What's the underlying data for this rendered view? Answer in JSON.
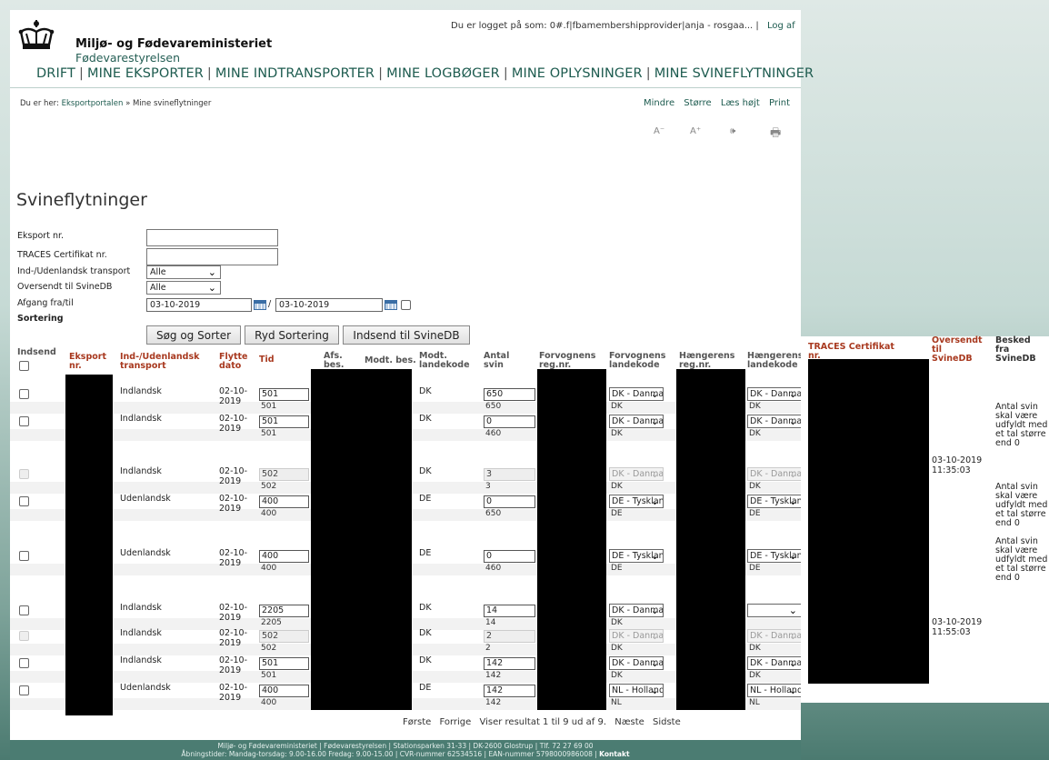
{
  "header": {
    "ministry": "Miljø- og Fødevareministeriet",
    "agency": "Fødevarestyrelsen",
    "login_text": "Du er logget på som: 0#.f|fbamembershipprovider|anja - rosgaa... |",
    "logout": "Log af",
    "nav": [
      "DRIFT",
      "MINE EKSPORTER",
      "MINE INDTRANSPORTER",
      "MINE LOGBØGER",
      "MINE OPLYSNINGER",
      "MINE SVINEFLYTNINGER"
    ]
  },
  "breadcrumb": {
    "prefix": "Du er her:",
    "link": "Eksportportalen",
    "sep": "»",
    "current": "Mine svineflytninger"
  },
  "tools": {
    "smaller": "Mindre",
    "larger": "Større",
    "read": "Læs højt",
    "print": "Print",
    "icon_smaller": "A⁻",
    "icon_larger": "A⁺",
    "icon_read": "🕪",
    "icon_print": "🖶"
  },
  "title": "Svineflytninger",
  "form": {
    "eksport_label": "Eksport nr.",
    "traces_label": "TRACES Certifikat nr.",
    "transport_label": "Ind-/Udenlandsk transport",
    "transport_value": "Alle",
    "sent_label": "Oversendt til SvineDB",
    "sent_value": "Alle",
    "date_label": "Afgang fra/til",
    "date_from": "03-10-2019",
    "date_sep": "/",
    "date_to": "03-10-2019",
    "sort_label": "Sortering"
  },
  "buttons": {
    "search": "Søg og Sorter",
    "clear": "Ryd Sortering",
    "submit": "Indsend til SvineDB"
  },
  "headers": {
    "indsend": "Indsend",
    "eksport": "Eksport nr.",
    "transport": "Ind-/Udenlandsk transport",
    "dato": "Flytte dato",
    "tid": "Tid",
    "afs": "Afs. bes.",
    "modt": "Modt. bes.",
    "modt_land": "Modt. landekode",
    "antal": "Antal svin",
    "forv_reg": "Forvognens reg.nr.",
    "forv_land": "Forvognens landekode",
    "haeng_reg": "Hængerens reg.nr.",
    "haeng_land": "Hængerens landekode",
    "traces": "TRACES Certifikat nr.",
    "oversendt": "Oversendt til SvineDB",
    "besked": "Besked fra SvineDB"
  },
  "rows": [
    {
      "transport": "Indlandsk",
      "date": "02-10-2019",
      "tid": "501",
      "tid_sub": "501",
      "land": "DK",
      "antal": "650",
      "antal_sub": "650",
      "forv": "DK - Danmark",
      "forv_sub": "DK",
      "haeng": "DK - Danmark",
      "haeng_sub": "DK",
      "oversendt": "",
      "besked": "",
      "disabled": false
    },
    {
      "transport": "Indlandsk",
      "date": "02-10-2019",
      "tid": "501",
      "tid_sub": "501",
      "land": "DK",
      "antal": "0",
      "antal_sub": "460",
      "forv": "DK - Danmark",
      "forv_sub": "DK",
      "haeng": "DK - Danmark",
      "haeng_sub": "DK",
      "oversendt": "",
      "besked": "Antal svin skal være udfyldt med et tal større end 0",
      "disabled": false
    },
    {
      "transport": "Indlandsk",
      "date": "02-10-2019",
      "tid": "502",
      "tid_sub": "502",
      "land": "DK",
      "antal": "3",
      "antal_sub": "3",
      "forv": "DK - Danmark",
      "forv_sub": "DK",
      "haeng": "DK - Danmark",
      "haeng_sub": "DK",
      "oversendt": "03-10-2019 11:35:03",
      "besked": "",
      "disabled": true
    },
    {
      "transport": "Udenlandsk",
      "date": "02-10-2019",
      "tid": "400",
      "tid_sub": "400",
      "land": "DE",
      "antal": "0",
      "antal_sub": "650",
      "forv": "DE - Tyskland",
      "forv_sub": "DE",
      "haeng": "DE - Tyskland",
      "haeng_sub": "DE",
      "oversendt": "",
      "besked": "Antal svin skal være udfyldt med et tal større end 0",
      "disabled": false
    },
    {
      "transport": "Udenlandsk",
      "date": "02-10-2019",
      "tid": "400",
      "tid_sub": "400",
      "land": "DE",
      "antal": "0",
      "antal_sub": "460",
      "forv": "DE - Tyskland",
      "forv_sub": "DE",
      "haeng": "DE - Tyskland",
      "haeng_sub": "DE",
      "oversendt": "",
      "besked": "Antal svin skal være udfyldt med et tal større end 0",
      "disabled": false
    },
    {
      "transport": "Indlandsk",
      "date": "02-10-2019",
      "tid": "2205",
      "tid_sub": "2205",
      "land": "DK",
      "antal": "14",
      "antal_sub": "14",
      "forv": "DK - Danmark",
      "forv_sub": "DK",
      "haeng": "",
      "haeng_sub": "",
      "oversendt": "",
      "besked": "",
      "disabled": false
    },
    {
      "transport": "Indlandsk",
      "date": "02-10-2019",
      "tid": "502",
      "tid_sub": "502",
      "land": "DK",
      "antal": "2",
      "antal_sub": "2",
      "forv": "DK - Danmark",
      "forv_sub": "DK",
      "haeng": "DK - Danmark",
      "haeng_sub": "DK",
      "oversendt": "03-10-2019 11:55:03",
      "besked": "",
      "disabled": true
    },
    {
      "transport": "Indlandsk",
      "date": "02-10-2019",
      "tid": "501",
      "tid_sub": "501",
      "land": "DK",
      "antal": "142",
      "antal_sub": "142",
      "forv": "DK - Danmark",
      "forv_sub": "DK",
      "haeng": "DK - Danmark",
      "haeng_sub": "DK",
      "oversendt": "",
      "besked": "",
      "disabled": false
    },
    {
      "transport": "Udenlandsk",
      "date": "02-10-2019",
      "tid": "400",
      "tid_sub": "400",
      "land": "DE",
      "antal": "142",
      "antal_sub": "142",
      "forv": "NL - Holland",
      "forv_sub": "NL",
      "haeng": "NL - Holland",
      "haeng_sub": "NL",
      "oversendt": "",
      "besked": "",
      "disabled": false
    }
  ],
  "pager": {
    "first": "Første",
    "prev": "Forrige",
    "info": "Viser resultat 1 til 9 ud af 9.",
    "next": "Næste",
    "last": "Sidste"
  },
  "footer": {
    "line1": "Miljø- og Fødevareministeriet | Fødevarestyrelsen | Stationsparken 31-33 | DK-2600 Glostrup | Tlf. 72 27 69 00",
    "line2": "Åbningstider: Mandag-torsdag: 9.00-16.00 Fredag: 9.00-15.00 | CVR-nummer 62534516 | EAN-nummer 5798000986008 |",
    "contact": "Kontakt"
  },
  "colors": {
    "brand_green": "#1d5b4f",
    "header_red": "#a8391f",
    "footer_bg": "#4b7c72"
  }
}
